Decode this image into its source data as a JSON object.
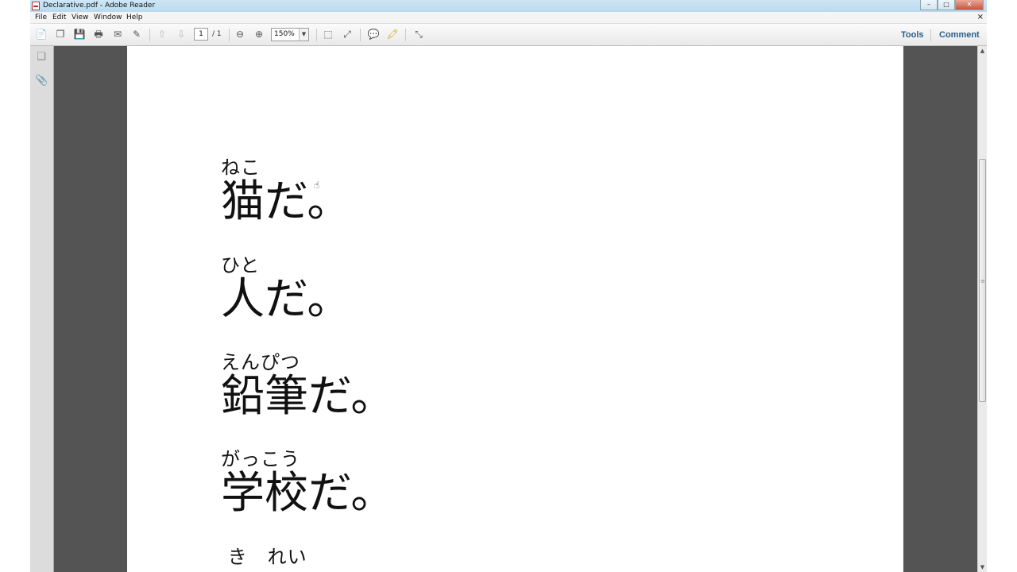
{
  "window": {
    "title": "Declarative.pdf - Adobe Reader",
    "controls": {
      "minimize": "–",
      "maximize": "□",
      "close": "✕"
    }
  },
  "menu": {
    "items": [
      "File",
      "Edit",
      "View",
      "Window",
      "Help"
    ],
    "close": "×"
  },
  "toolbar": {
    "page_current": "1",
    "page_total": "/ 1",
    "zoom": "150%",
    "zoom_arrow": "▼",
    "tools_label": "Tools",
    "comment_label": "Comment"
  },
  "icons": {
    "create_pdf": "📄",
    "combine": "❐",
    "save": "💾",
    "print": "🖶",
    "email": "✉",
    "edit": "✎",
    "page_up": "⇧",
    "page_down": "⇩",
    "zoom_out": "⊖",
    "zoom_in": "⊕",
    "fit_page": "⬚",
    "fit_width": "⤢",
    "sticky_note": "💬",
    "highlight": "🖍",
    "expand": "⤡",
    "pages": "❏",
    "attachment": "📎",
    "cursor": "☝",
    "scroll_up": "▲",
    "scroll_down": "▼",
    "grip": "≡"
  },
  "document": {
    "entries": [
      {
        "furigana": "ねこ",
        "text": "猫だ。"
      },
      {
        "furigana": "ひと",
        "text": "人だ。"
      },
      {
        "furigana": "えんぴつ",
        "text": "鉛筆だ。"
      },
      {
        "furigana": "がっこう",
        "text": "学校だ。"
      },
      {
        "furigana": " き　れい",
        "text": ""
      }
    ]
  }
}
